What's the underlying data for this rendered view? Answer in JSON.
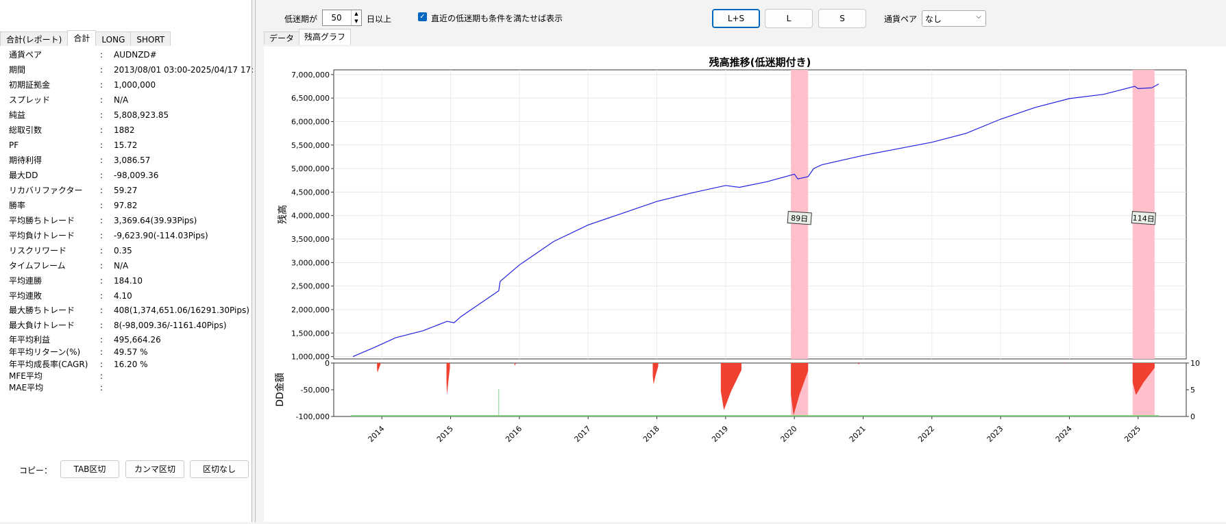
{
  "left_tabs": [
    "合計(レポート)",
    "合計",
    "LONG",
    "SHORT"
  ],
  "stats": [
    {
      "k": "通貨ペア",
      "v": "AUDNZD#"
    },
    {
      "k": "期間",
      "v": "2013/08/01 03:00-2025/04/17 17:"
    },
    {
      "k": "初期証拠金",
      "v": "1,000,000"
    },
    {
      "k": "スプレッド",
      "v": "N/A"
    },
    {
      "k": "純益",
      "v": "5,808,923.85"
    },
    {
      "k": "総取引数",
      "v": "1882"
    },
    {
      "k": "PF",
      "v": "15.72"
    },
    {
      "k": "期待利得",
      "v": "3,086.57"
    },
    {
      "k": "最大DD",
      "v": "-98,009.36"
    },
    {
      "k": "リカバリファクター",
      "v": "59.27"
    },
    {
      "k": "勝率",
      "v": "97.82"
    },
    {
      "k": "平均勝ちトレード",
      "v": "3,369.64(39.93Pips)"
    },
    {
      "k": "平均負けトレード",
      "v": "-9,623.90(-114.03Pips)"
    },
    {
      "k": "リスクリワード",
      "v": "0.35"
    },
    {
      "k": "タイムフレーム",
      "v": "N/A"
    },
    {
      "k": "平均連勝",
      "v": "184.10"
    },
    {
      "k": "平均連敗",
      "v": "4.10"
    },
    {
      "k": "最大勝ちトレード",
      "v": "408(1,374,651.06/16291.30Pips)"
    },
    {
      "k": "最大負けトレード",
      "v": "8(-98,009.36/-1161.40Pips)"
    },
    {
      "k": "年平均利益",
      "v": "495,664.26"
    },
    {
      "k": "年平均リターン(%)",
      "v": "49.57 %"
    },
    {
      "k": "年平均成長率(CAGR)",
      "v": "16.20 %"
    },
    {
      "k": "MFE平均",
      "v": ""
    },
    {
      "k": "MAE平均",
      "v": ""
    }
  ],
  "colon": ":",
  "copy": {
    "label": "コピー：",
    "buttons": [
      "TAB区切",
      "カンマ区切",
      "区切なし"
    ]
  },
  "toolbar": {
    "slump_label": "低迷期が",
    "slump_value": "50",
    "slump_suffix": "日以上",
    "recent_check_label": "直近の低迷期も条件を満たせば表示",
    "mode_buttons": [
      "L+S",
      "L",
      "S"
    ],
    "active_mode": "L+S",
    "pair_label": "通貨ペア",
    "pair_value": "なし"
  },
  "subtabs": [
    "データ",
    "残高グラフ"
  ],
  "colors": {
    "line": "#2020e0",
    "slump": "#ffc0cb",
    "dd": "#f04030",
    "trades": "#80d080",
    "active_border": "#0067c0"
  },
  "chart_data": [
    {
      "type": "line",
      "title": "残高推移(低迷期付き)",
      "ylabel": "残高",
      "ylim": [
        950000,
        7100000
      ],
      "yticks": [
        1000000,
        1500000,
        2000000,
        2500000,
        3000000,
        3500000,
        4000000,
        4500000,
        5000000,
        5500000,
        6000000,
        6500000,
        7000000
      ],
      "ytick_labels": [
        "1,000,000",
        "1,500,000",
        "2,000,000",
        "2,500,000",
        "3,000,000",
        "3,500,000",
        "4,000,000",
        "4,500,000",
        "5,000,000",
        "5,500,000",
        "6,000,000",
        "6,500,000",
        "7,000,000"
      ],
      "xlim": [
        2013.3,
        2025.7
      ],
      "grid": true,
      "series": [
        {
          "x": [
            2013.58,
            2013.9,
            2014.2,
            2014.6,
            2014.95,
            2015.05,
            2015.15,
            2015.5,
            2015.7,
            2015.72,
            2016.0,
            2016.5,
            2017.0,
            2017.5,
            2018.0,
            2018.5,
            2019.0,
            2019.2,
            2019.6,
            2020.0,
            2020.05,
            2020.2,
            2020.28,
            2020.4,
            2021.0,
            2021.5,
            2022.0,
            2022.5,
            2023.0,
            2023.5,
            2024.0,
            2024.5,
            2024.95,
            2025.0,
            2025.2,
            2025.3
          ],
          "y": [
            1000000,
            1200000,
            1400000,
            1550000,
            1750000,
            1720000,
            1850000,
            2200000,
            2400000,
            2600000,
            2950000,
            3450000,
            3800000,
            4050000,
            4300000,
            4480000,
            4640000,
            4600000,
            4720000,
            4880000,
            4780000,
            4830000,
            5000000,
            5080000,
            5280000,
            5420000,
            5560000,
            5750000,
            6050000,
            6300000,
            6490000,
            6580000,
            6750000,
            6700000,
            6720000,
            6800000
          ]
        }
      ],
      "slump_periods": [
        {
          "start": 2019.95,
          "end": 2020.2,
          "label": "89日"
        },
        {
          "start": 2024.92,
          "end": 2025.24,
          "label": "114日"
        }
      ]
    },
    {
      "type": "area",
      "ylabel": "DD金額",
      "ylim": [
        -100000,
        0
      ],
      "yticks": [
        0,
        -50000,
        -100000
      ],
      "ytick_labels": [
        "0",
        "-50,000",
        "-100,000"
      ],
      "y2ticks": [
        10,
        5,
        0
      ],
      "x_tick_labels": [
        "2014",
        "2015",
        "2016",
        "2017",
        "2018",
        "2019",
        "2020",
        "2021",
        "2022",
        "2023",
        "2024",
        "2025"
      ],
      "drawdowns": [
        {
          "start": 2013.93,
          "end": 2013.98,
          "min": -18000
        },
        {
          "start": 2014.94,
          "end": 2014.99,
          "min": -60000
        },
        {
          "start": 2015.93,
          "end": 2015.95,
          "min": -5000
        },
        {
          "start": 2017.94,
          "end": 2018.02,
          "min": -40000
        },
        {
          "start": 2018.93,
          "end": 2019.23,
          "min": -88000
        },
        {
          "start": 2019.95,
          "end": 2020.2,
          "min": -98000
        },
        {
          "start": 2020.93,
          "end": 2020.95,
          "min": -3000
        },
        {
          "start": 2023.93,
          "end": 2023.95,
          "min": -1500
        },
        {
          "start": 2024.92,
          "end": 2025.24,
          "min": -60000
        }
      ]
    }
  ]
}
